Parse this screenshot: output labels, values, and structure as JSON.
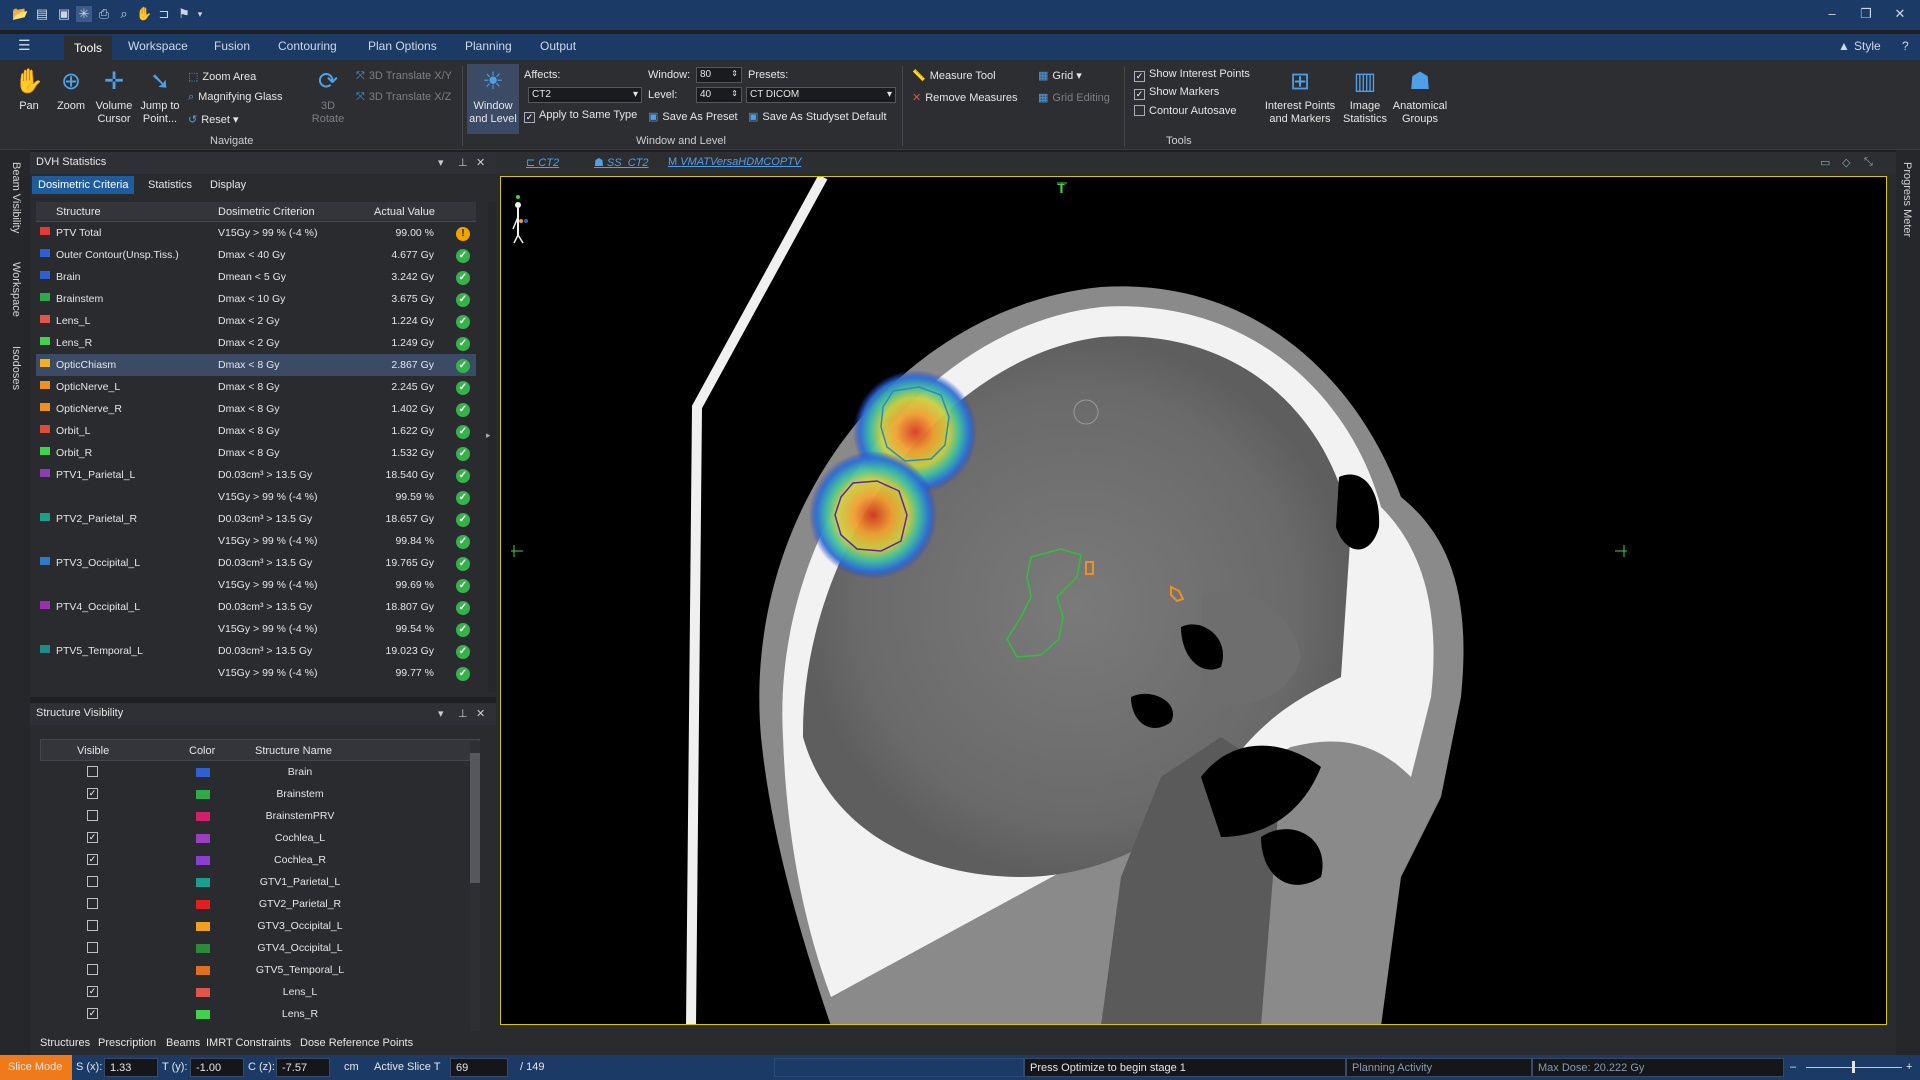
{
  "quick_access": {
    "icons": [
      "open-folder-icon",
      "folder-icon",
      "save-icon",
      "settings-icon",
      "print-icon",
      "zoom-icon",
      "hand-icon",
      "layout-icon",
      "flag-icon",
      "dropdown-icon"
    ]
  },
  "window_controls": {
    "minimize": "–",
    "restore": "❐",
    "close": "✕"
  },
  "menu": {
    "hamburger": "☰"
  },
  "tabs": [
    {
      "label": "Tools",
      "active": true
    },
    {
      "label": "Workspace"
    },
    {
      "label": "Fusion"
    },
    {
      "label": "Contouring"
    },
    {
      "label": "Plan Options"
    },
    {
      "label": "Planning"
    },
    {
      "label": "Output"
    }
  ],
  "style_menu": {
    "label": "Style",
    "help": "?"
  },
  "ribbon": {
    "navigate": {
      "group_label": "Navigate",
      "pan": "Pan",
      "zoom": "Zoom",
      "volume_cursor_1": "Volume",
      "volume_cursor_2": "Cursor",
      "jump_1": "Jump to",
      "jump_2": "Point...",
      "zoom_area": "Zoom Area",
      "magnifying_glass": "Magnifying Glass",
      "reset": "Reset",
      "rotate_1": "3D",
      "rotate_2": "Rotate",
      "translate_xy": "3D Translate X/Y",
      "translate_xz": "3D Translate X/Z"
    },
    "window_level": {
      "group_label": "Window and Level",
      "btn_1": "Window",
      "btn_2": "and Level",
      "affects_label": "Affects:",
      "affects_value": "CT2",
      "window_label": "Window:",
      "window_value": "80",
      "level_label": "Level:",
      "level_value": "40",
      "presets_label": "Presets:",
      "presets_value": "CT DICOM",
      "apply_same_type": "Apply to Same Type",
      "save_preset": "Save As Preset",
      "save_studyset": "Save As Studyset Default"
    },
    "tools": {
      "group_label": "Tools",
      "measure_tool": "Measure Tool",
      "remove_measures": "Remove Measures",
      "grid": "Grid",
      "grid_editing": "Grid Editing",
      "show_interest_points": "Show Interest Points",
      "show_markers": "Show Markers",
      "contour_autosave": "Contour Autosave",
      "interest_1": "Interest Points",
      "interest_2": "and Markers",
      "image_stats_1": "Image",
      "image_stats_2": "Statistics",
      "anat_1": "Anatomical",
      "anat_2": "Groups"
    }
  },
  "left_tabs": [
    "Beam Visibility",
    "Workspace",
    "Isodoses"
  ],
  "dvh_panel": {
    "title": "DVH Statistics",
    "subtabs": [
      "Dosimetric Criteria",
      "Statistics",
      "Display"
    ],
    "headers": {
      "structure": "Structure",
      "criterion": "Dosimetric Criterion",
      "value": "Actual Value"
    },
    "rows": [
      {
        "structure": "PTV Total",
        "color": "#e53935",
        "criterion": "V15Gy > 99 % (-4 %)",
        "value": "99.00 %",
        "status": "warn"
      },
      {
        "structure": "Outer Contour(Unsp.Tiss.)",
        "color": "#2f5fd0",
        "criterion": "Dmax < 40 Gy",
        "value": "4.677 Gy",
        "status": "ok"
      },
      {
        "structure": "Brain",
        "color": "#2f5fd0",
        "criterion": "Dmean < 5 Gy",
        "value": "3.242 Gy",
        "status": "ok"
      },
      {
        "structure": "Brainstem",
        "color": "#2eaa4a",
        "criterion": "Dmax < 10 Gy",
        "value": "3.675 Gy",
        "status": "ok"
      },
      {
        "structure": "Lens_L",
        "color": "#e0564a",
        "criterion": "Dmax < 2 Gy",
        "value": "1.224 Gy",
        "status": "ok"
      },
      {
        "structure": "Lens_R",
        "color": "#3fd24a",
        "criterion": "Dmax < 2 Gy",
        "value": "1.249 Gy",
        "status": "ok"
      },
      {
        "structure": "OpticChiasm",
        "color": "#f0b020",
        "criterion": "Dmax < 8 Gy",
        "value": "2.867 Gy",
        "status": "ok",
        "selected": true
      },
      {
        "structure": "OpticNerve_L",
        "color": "#f09020",
        "criterion": "Dmax < 8 Gy",
        "value": "2.245 Gy",
        "status": "ok"
      },
      {
        "structure": "OpticNerve_R",
        "color": "#f09020",
        "criterion": "Dmax < 8 Gy",
        "value": "1.402 Gy",
        "status": "ok"
      },
      {
        "structure": "Orbit_L",
        "color": "#e04a3a",
        "criterion": "Dmax < 8 Gy",
        "value": "1.622 Gy",
        "status": "ok"
      },
      {
        "structure": "Orbit_R",
        "color": "#3fd24a",
        "criterion": "Dmax < 8 Gy",
        "value": "1.532 Gy",
        "status": "ok"
      },
      {
        "structure": "PTV1_Parietal_L",
        "color": "#8a3fb0",
        "criterion": "D0.03cm³ > 13.5 Gy",
        "value": "18.540 Gy",
        "status": "ok"
      },
      {
        "structure": "",
        "color": "",
        "criterion": "V15Gy > 99 % (-4 %)",
        "value": "99.59 %",
        "status": "ok"
      },
      {
        "structure": "PTV2_Parietal_R",
        "color": "#1aa08a",
        "criterion": "D0.03cm³ > 13.5 Gy",
        "value": "18.657 Gy",
        "status": "ok"
      },
      {
        "structure": "",
        "color": "",
        "criterion": "V15Gy > 99 % (-4 %)",
        "value": "99.84 %",
        "status": "ok"
      },
      {
        "structure": "PTV3_Occipital_L",
        "color": "#2f7ac8",
        "criterion": "D0.03cm³ > 13.5 Gy",
        "value": "19.765 Gy",
        "status": "ok"
      },
      {
        "structure": "",
        "color": "",
        "criterion": "V15Gy > 99 % (-4 %)",
        "value": "99.69 %",
        "status": "ok"
      },
      {
        "structure": "PTV4_Occipital_L",
        "color": "#9a2fb0",
        "criterion": "D0.03cm³ > 13.5 Gy",
        "value": "18.807 Gy",
        "status": "ok"
      },
      {
        "structure": "",
        "color": "",
        "criterion": "V15Gy > 99 % (-4 %)",
        "value": "99.54 %",
        "status": "ok"
      },
      {
        "structure": "PTV5_Temporal_L",
        "color": "#1f8a8a",
        "criterion": "D0.03cm³ > 13.5 Gy",
        "value": "19.023 Gy",
        "status": "ok"
      },
      {
        "structure": "",
        "color": "",
        "criterion": "V15Gy > 99 % (-4 %)",
        "value": "99.77 %",
        "status": "ok"
      }
    ]
  },
  "sv_panel": {
    "title": "Structure Visibility",
    "headers": {
      "visible": "Visible",
      "color": "Color",
      "name": "Structure Name"
    },
    "rows": [
      {
        "name": "Brain",
        "visible": false,
        "color": "#2f5fd0"
      },
      {
        "name": "Brainstem",
        "visible": true,
        "color": "#2eaa4a"
      },
      {
        "name": "BrainstemPRV",
        "visible": false,
        "color": "#d0206a"
      },
      {
        "name": "Cochlea_L",
        "visible": true,
        "color": "#9a3fc0"
      },
      {
        "name": "Cochlea_R",
        "visible": true,
        "color": "#8a3fd0"
      },
      {
        "name": "GTV1_Parietal_L",
        "visible": false,
        "color": "#1aa08a"
      },
      {
        "name": "GTV2_Parietal_R",
        "visible": false,
        "color": "#e02020"
      },
      {
        "name": "GTV3_Occipital_L",
        "visible": false,
        "color": "#f0a020"
      },
      {
        "name": "GTV4_Occipital_L",
        "visible": false,
        "color": "#2e8a3a"
      },
      {
        "name": "GTV5_Temporal_L",
        "visible": false,
        "color": "#e07020"
      },
      {
        "name": "Lens_L",
        "visible": true,
        "color": "#e0564a"
      },
      {
        "name": "Lens_R",
        "visible": true,
        "color": "#3fd24a"
      }
    ]
  },
  "bottom_tabs": [
    "Structures",
    "Prescription",
    "Beams",
    "IMRT Constraints",
    "Dose Reference Points"
  ],
  "viewer": {
    "tabs": [
      "CT2",
      "SS_CT2",
      "VMATVersaHDMCOPTV"
    ],
    "orientation_top": "T"
  },
  "right_tab": "Progress Meter",
  "status": {
    "mode": "Slice Mode",
    "s_label": "S (x):",
    "s_value": "1.33",
    "t_label": "T (y):",
    "t_value": "-1.00",
    "c_label": "C (z):",
    "c_value": "-7.57",
    "unit": "cm",
    "active_slice_label": "Active Slice T",
    "slice_value": "69",
    "slice_total": "/ 149",
    "message": "Press Optimize to begin stage 1",
    "activity": "Planning Activity",
    "max_dose": "Max Dose: 20.222 Gy"
  }
}
